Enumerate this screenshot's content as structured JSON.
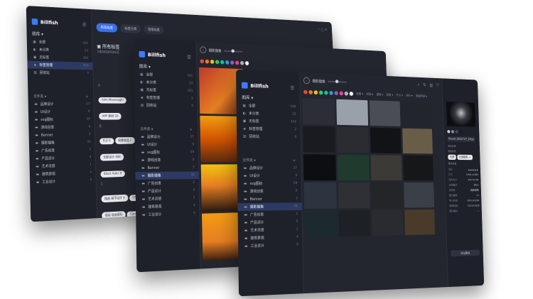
{
  "app": {
    "name": "Billfish",
    "library_label": "图库 ▾"
  },
  "traffic_colors": {
    "close": "#ff5f57",
    "min": "#febc2e",
    "max": "#28c840"
  },
  "nav": [
    {
      "icon": "grid-icon",
      "glyph": "▦",
      "label": "全部",
      "count": "161"
    },
    {
      "icon": "unsorted-icon",
      "glyph": "◐",
      "label": "未分类",
      "count": "23"
    },
    {
      "icon": "tag-icon",
      "glyph": "▣",
      "label": "无标签",
      "count": "161"
    },
    {
      "icon": "tag-manage-icon",
      "glyph": "◈",
      "label": "标签管理",
      "count": "429"
    },
    {
      "icon": "trash-icon",
      "glyph": "▥",
      "label": "回收站",
      "count": "0"
    }
  ],
  "nav_w2": [
    {
      "icon": "grid-icon",
      "glyph": "▦",
      "label": "全部",
      "count": "161"
    },
    {
      "icon": "unsorted-icon",
      "glyph": "◐",
      "label": "未分类",
      "count": "23"
    },
    {
      "icon": "tag-icon",
      "glyph": "▣",
      "label": "无标签",
      "count": "161"
    },
    {
      "icon": "tag-manage-icon",
      "glyph": "◈",
      "label": "标签管理",
      "count": "2"
    },
    {
      "icon": "trash-icon",
      "glyph": "▥",
      "label": "回收站",
      "count": "0"
    }
  ],
  "nav_w3": [
    {
      "icon": "grid-icon",
      "glyph": "▦",
      "label": "全部",
      "count": "166"
    },
    {
      "icon": "unsorted-icon",
      "glyph": "◐",
      "label": "未分类",
      "count": "23"
    },
    {
      "icon": "tag-icon",
      "glyph": "▣",
      "label": "无标签",
      "count": "143"
    },
    {
      "icon": "tag-manage-icon",
      "glyph": "◈",
      "label": "标签管理",
      "count": "2"
    },
    {
      "icon": "trash-icon",
      "glyph": "▥",
      "label": "回收站",
      "count": "0"
    }
  ],
  "folders_label": "文件夹 ▾",
  "folders_w1": [
    {
      "label": "品牌设计",
      "count": "27"
    },
    {
      "label": "UI设计",
      "count": "9"
    },
    {
      "label": "svg图标",
      "count": "59"
    },
    {
      "label": "游戏创意",
      "count": "8"
    },
    {
      "label": "Banner",
      "count": "3"
    },
    {
      "label": "摄影摄像",
      "count": "35"
    },
    {
      "label": "广告创意",
      "count": "2"
    },
    {
      "label": "产品设计",
      "count": "4"
    },
    {
      "label": "艺术灵感",
      "count": "1"
    },
    {
      "label": "建筑景观",
      "count": "4"
    },
    {
      "label": "工业设计",
      "count": "0"
    }
  ],
  "folders_w2": [
    {
      "label": "品牌设计",
      "count": "27"
    },
    {
      "label": "UI设计",
      "count": "9"
    },
    {
      "label": "svg图标",
      "count": "59"
    },
    {
      "label": "游戏创意",
      "count": "0"
    },
    {
      "label": "Banner",
      "count": "3"
    },
    {
      "label": "摄影摄像",
      "count": "35"
    },
    {
      "label": "广告创意",
      "count": "2"
    },
    {
      "label": "产品设计",
      "count": "0"
    },
    {
      "label": "艺术灵感",
      "count": "1"
    },
    {
      "label": "建筑景观",
      "count": "4"
    },
    {
      "label": "工业设计",
      "count": "0"
    }
  ],
  "folders_w3": [
    {
      "label": "品牌设计",
      "count": "27"
    },
    {
      "label": "UI设计",
      "count": "9"
    },
    {
      "label": "svg图标",
      "count": "59"
    },
    {
      "label": "游戏创意",
      "count": "0"
    },
    {
      "label": "Banner",
      "count": "3"
    },
    {
      "label": "摄影摄像",
      "count": "21"
    },
    {
      "label": "广告创意",
      "count": "2"
    },
    {
      "label": "产品设计",
      "count": "0"
    },
    {
      "label": "艺术灵感",
      "count": "1"
    },
    {
      "label": "建筑景观",
      "count": "4"
    },
    {
      "label": "工业设计",
      "count": "0"
    }
  ],
  "tag_tabs": [
    "所有标签",
    "标签分类",
    "常用标签"
  ],
  "tag_panel": {
    "title": "所有标签",
    "subtitle": "为素材快速添加标签"
  },
  "tag_groups": [
    {
      "letter": "A",
      "chips": [
        "Alim Maassaghi",
        "APP 素材 10"
      ]
    },
    {
      "letter": "B",
      "chips": [
        "ELE 0",
        "保健食品 1",
        "北欧设计 486",
        "Black Italic 9"
      ]
    },
    {
      "letter": "C",
      "chips": [
        "插画 扁平设计 4",
        "CAD 51",
        "插画 插画图标",
        "Canva 1"
      ]
    }
  ],
  "folder_title": "摄影摄像",
  "filters": [
    "标签 ▾",
    "时间 ▾",
    "类型 ▾",
    "形状 ▾",
    "尺寸 ▾",
    "评分 ▾",
    "添加时间 ▾"
  ],
  "palette": [
    "#e74c3c",
    "#e67e22",
    "#f1c40f",
    "#2ecc71",
    "#1abc9c",
    "#3498db",
    "#9b59b6",
    "#e84393",
    "#b0b4bf",
    "#ffffff"
  ],
  "thumbs_w2": [
    "linear-gradient(135deg,#c0392b,#e67e22 60%,#6e2c1a)",
    "linear-gradient(180deg,#f39c12,#d35400 50%,#5a2a10)",
    "linear-gradient(180deg,#f1c40f,#e67e22 45%,#2c1a10)",
    "linear-gradient(180deg,#f39c12,#e67e22 60%,#3a1f10)"
  ],
  "thumbs_w3": [
    "#2b2e36",
    "#9aa0aa",
    "#4a4d55",
    "#23252c",
    "#1a1b20",
    "#2a2c32",
    "#121316",
    "#6a5d48",
    "#0d0e11",
    "#1f3b2e",
    "#3c3a36",
    "#161719",
    "#2c3440",
    "#2e3035",
    "#242528",
    "#3a3f48",
    "#1c2a2e",
    "#1d2025",
    "#2a2b30",
    "#4a3a2a"
  ],
  "inspector": {
    "swatches": [
      "#c8ccd3",
      "#8b8f97",
      "#4a4d55",
      "#1b1c20"
    ],
    "filename": "Pexels-2042727_10(p)",
    "note_label": "添加注释",
    "tags_label": "添加标签",
    "tags": [
      "风景",
      "玩偶摄影 +"
    ],
    "info_label": "基本信息",
    "rows": [
      {
        "k": "评分",
        "v": "★★★★★"
      },
      {
        "k": "尺寸",
        "v": "1920×1080"
      },
      {
        "k": "文件大小",
        "v": "405.52 KB"
      },
      {
        "k": "文件格式",
        "v": "JPEG"
      },
      {
        "k": "文件夹",
        "v": "摄影摄像"
      },
      {
        "k": "图片编号",
        "v": "12"
      },
      {
        "k": "导入时间",
        "v": "2021/10/26"
      },
      {
        "k": "修改时间",
        "v": "2021/10/26"
      },
      {
        "k": "图片备注",
        "v": "—"
      }
    ],
    "export_label": "导出素材"
  }
}
